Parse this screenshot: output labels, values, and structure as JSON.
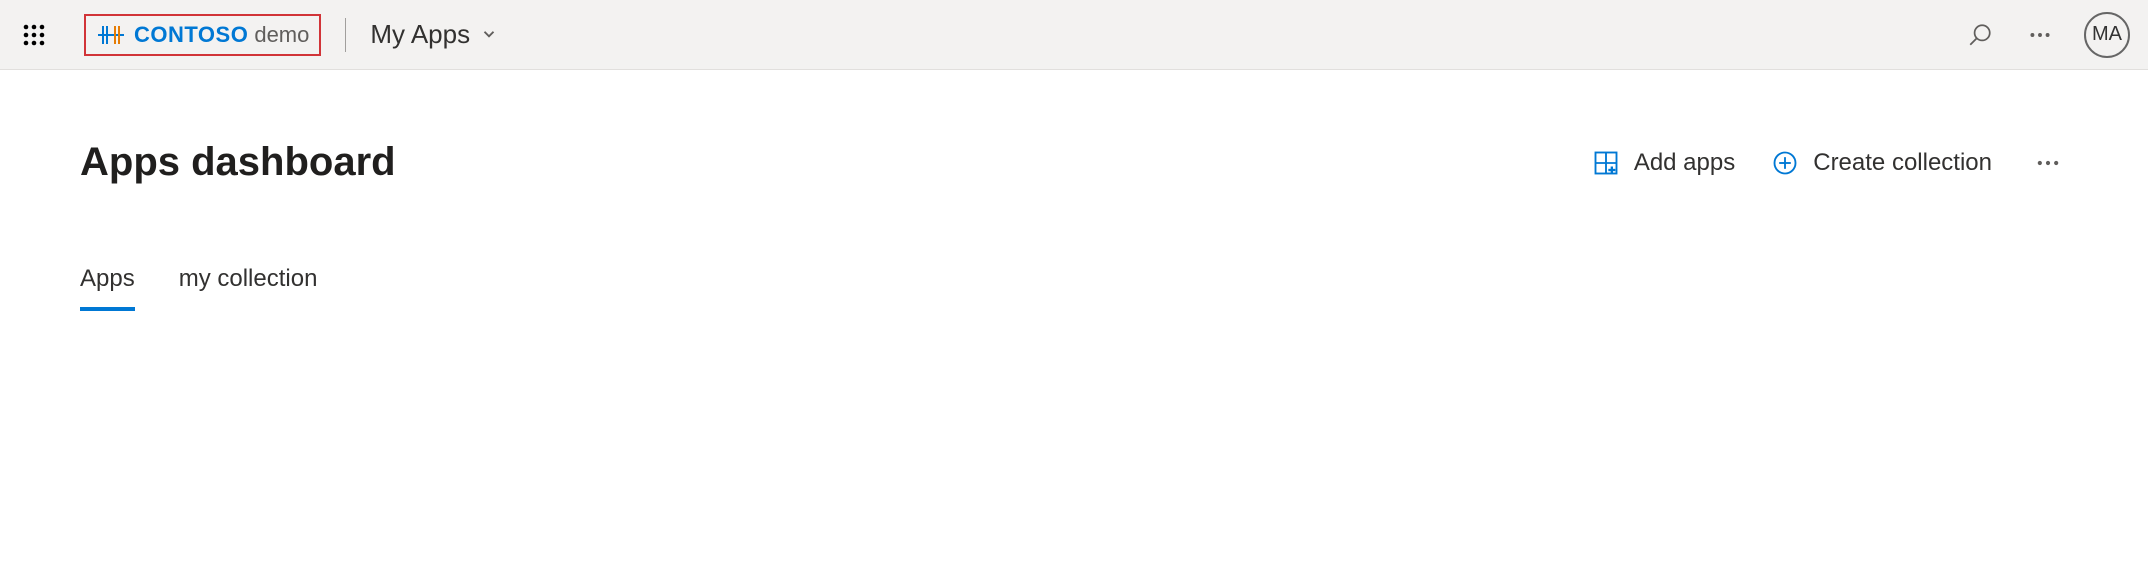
{
  "header": {
    "brand_main": "CONTOSO",
    "brand_sub": "demo",
    "app_dropdown_label": "My Apps",
    "avatar_initials": "MA"
  },
  "page": {
    "title": "Apps dashboard",
    "actions": {
      "add_apps": "Add apps",
      "create_collection": "Create collection"
    },
    "tabs": [
      {
        "label": "Apps",
        "active": true
      },
      {
        "label": "my collection",
        "active": false
      }
    ]
  }
}
